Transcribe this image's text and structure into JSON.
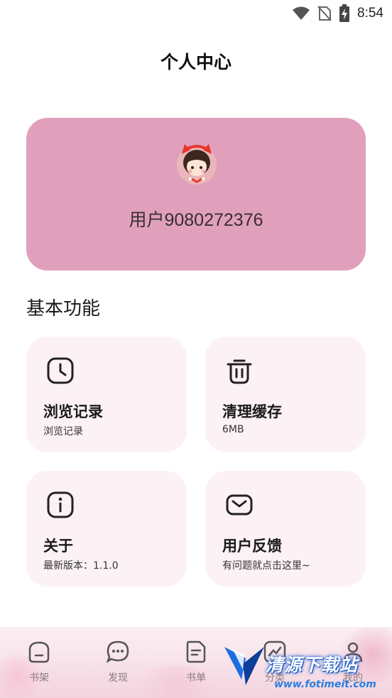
{
  "status_bar": {
    "time": "8:54",
    "icons": [
      "wifi-icon",
      "no-sim-icon",
      "battery-charging-icon"
    ]
  },
  "header": {
    "title": "个人中心"
  },
  "profile": {
    "username": "用户9080272376",
    "avatar": "cartoon-girl-avatar"
  },
  "section": {
    "title": "基本功能"
  },
  "features": [
    {
      "title": "浏览记录",
      "subtitle": "浏览记录",
      "icon": "clock-icon"
    },
    {
      "title": "清理缓存",
      "subtitle": "6MB",
      "icon": "trash-icon"
    },
    {
      "title": "关于",
      "subtitle": "最新版本：1.1.0",
      "icon": "info-icon"
    },
    {
      "title": "用户反馈",
      "subtitle": "有问题就点击这里~",
      "icon": "mail-icon"
    }
  ],
  "bottom_nav": [
    {
      "label": "书架",
      "icon": "shelf-icon"
    },
    {
      "label": "发现",
      "icon": "discover-chat-icon"
    },
    {
      "label": "书单",
      "icon": "booklist-icon"
    },
    {
      "label": "分类",
      "icon": "category-chart-icon"
    },
    {
      "label": "我的",
      "icon": "profile-icon"
    }
  ],
  "watermark": {
    "title": "清源下载站",
    "url": "www.fotimeit.com"
  },
  "colors": {
    "card_pink": "#e0a0bc",
    "feature_bg": "#fcf1f4",
    "nav_bg": "#f7e1e9"
  }
}
